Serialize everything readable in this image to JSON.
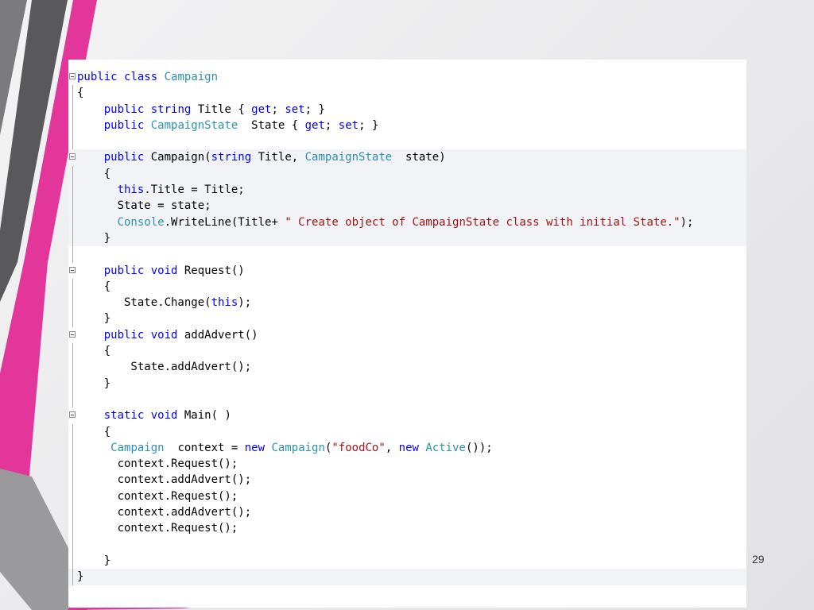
{
  "slide": {
    "page_number": "29",
    "colors": {
      "accent_pink": "#e2369a",
      "dark_stripe": "#5a5a5c",
      "mid_stripe": "#7d7d80"
    }
  },
  "code": {
    "lines": [
      {
        "tokens": [
          [
            "kw",
            "public"
          ],
          [
            "pl",
            " "
          ],
          [
            "kw",
            "class"
          ],
          [
            "pl",
            " "
          ],
          [
            "ty",
            "Campaign"
          ]
        ],
        "fold": true
      },
      {
        "tokens": [
          [
            "pl",
            "{"
          ]
        ]
      },
      {
        "tokens": [
          [
            "pl",
            "    "
          ],
          [
            "kw",
            "public"
          ],
          [
            "pl",
            " "
          ],
          [
            "kw",
            "string"
          ],
          [
            "pl",
            " Title { "
          ],
          [
            "kw",
            "get"
          ],
          [
            "pl",
            "; "
          ],
          [
            "kw",
            "set"
          ],
          [
            "pl",
            "; }"
          ]
        ]
      },
      {
        "tokens": [
          [
            "pl",
            "    "
          ],
          [
            "kw",
            "public"
          ],
          [
            "pl",
            " "
          ],
          [
            "ty",
            "CampaignState"
          ],
          [
            "pl",
            "  State { "
          ],
          [
            "kw",
            "get"
          ],
          [
            "pl",
            "; "
          ],
          [
            "kw",
            "set"
          ],
          [
            "pl",
            "; }"
          ]
        ]
      },
      {
        "tokens": [
          [
            "pl",
            ""
          ]
        ]
      },
      {
        "tokens": [
          [
            "pl",
            "    "
          ],
          [
            "kw",
            "public"
          ],
          [
            "pl",
            " Campaign("
          ],
          [
            "kw",
            "string"
          ],
          [
            "pl",
            " Title, "
          ],
          [
            "ty",
            "CampaignState"
          ],
          [
            "pl",
            "  state)"
          ]
        ],
        "fold": true,
        "hl": true
      },
      {
        "tokens": [
          [
            "pl",
            "    {"
          ]
        ],
        "hl": true
      },
      {
        "tokens": [
          [
            "pl",
            "      "
          ],
          [
            "kw",
            "this"
          ],
          [
            "pl",
            ".Title = Title;"
          ]
        ],
        "hl": true
      },
      {
        "tokens": [
          [
            "pl",
            "      State = state;"
          ]
        ],
        "hl": true
      },
      {
        "tokens": [
          [
            "pl",
            "      "
          ],
          [
            "ty",
            "Console"
          ],
          [
            "pl",
            ".WriteLine(Title+ "
          ],
          [
            "st",
            "\" Create object of CampaignState class with initial State.\""
          ],
          [
            "pl",
            ");"
          ]
        ],
        "hl": true
      },
      {
        "tokens": [
          [
            "pl",
            "    }"
          ]
        ],
        "hl": true
      },
      {
        "tokens": [
          [
            "pl",
            ""
          ]
        ]
      },
      {
        "tokens": [
          [
            "pl",
            "    "
          ],
          [
            "kw",
            "public"
          ],
          [
            "pl",
            " "
          ],
          [
            "kw",
            "void"
          ],
          [
            "pl",
            " Request()"
          ]
        ],
        "fold": true
      },
      {
        "tokens": [
          [
            "pl",
            "    {"
          ]
        ]
      },
      {
        "tokens": [
          [
            "pl",
            "       State.Change("
          ],
          [
            "kw",
            "this"
          ],
          [
            "pl",
            ");"
          ]
        ]
      },
      {
        "tokens": [
          [
            "pl",
            "    }"
          ]
        ]
      },
      {
        "tokens": [
          [
            "pl",
            "    "
          ],
          [
            "kw",
            "public"
          ],
          [
            "pl",
            " "
          ],
          [
            "kw",
            "void"
          ],
          [
            "pl",
            " addAdvert()"
          ]
        ],
        "fold": true
      },
      {
        "tokens": [
          [
            "pl",
            "    {"
          ]
        ]
      },
      {
        "tokens": [
          [
            "pl",
            "        State.addAdvert();"
          ]
        ]
      },
      {
        "tokens": [
          [
            "pl",
            "    }"
          ]
        ]
      },
      {
        "tokens": [
          [
            "pl",
            ""
          ]
        ]
      },
      {
        "tokens": [
          [
            "pl",
            "    "
          ],
          [
            "kw",
            "static"
          ],
          [
            "pl",
            " "
          ],
          [
            "kw",
            "void"
          ],
          [
            "pl",
            " Main( )"
          ]
        ],
        "fold": true
      },
      {
        "tokens": [
          [
            "pl",
            "    {"
          ]
        ]
      },
      {
        "tokens": [
          [
            "pl",
            "     "
          ],
          [
            "ty",
            "Campaign"
          ],
          [
            "pl",
            "  context = "
          ],
          [
            "kw",
            "new"
          ],
          [
            "pl",
            " "
          ],
          [
            "ty",
            "Campaign"
          ],
          [
            "pl",
            "("
          ],
          [
            "st",
            "\"foodCo\""
          ],
          [
            "pl",
            ", "
          ],
          [
            "kw",
            "new"
          ],
          [
            "pl",
            " "
          ],
          [
            "ty",
            "Active"
          ],
          [
            "pl",
            "());"
          ]
        ]
      },
      {
        "tokens": [
          [
            "pl",
            "      context.Request();"
          ]
        ]
      },
      {
        "tokens": [
          [
            "pl",
            "      context.addAdvert();"
          ]
        ]
      },
      {
        "tokens": [
          [
            "pl",
            "      context.Request();"
          ]
        ]
      },
      {
        "tokens": [
          [
            "pl",
            "      context.addAdvert();"
          ]
        ]
      },
      {
        "tokens": [
          [
            "pl",
            "      context.Request();"
          ]
        ]
      },
      {
        "tokens": [
          [
            "pl",
            ""
          ]
        ]
      },
      {
        "tokens": [
          [
            "pl",
            "    }"
          ]
        ]
      },
      {
        "tokens": [
          [
            "pl",
            "}"
          ]
        ],
        "hl_end": true
      }
    ]
  }
}
